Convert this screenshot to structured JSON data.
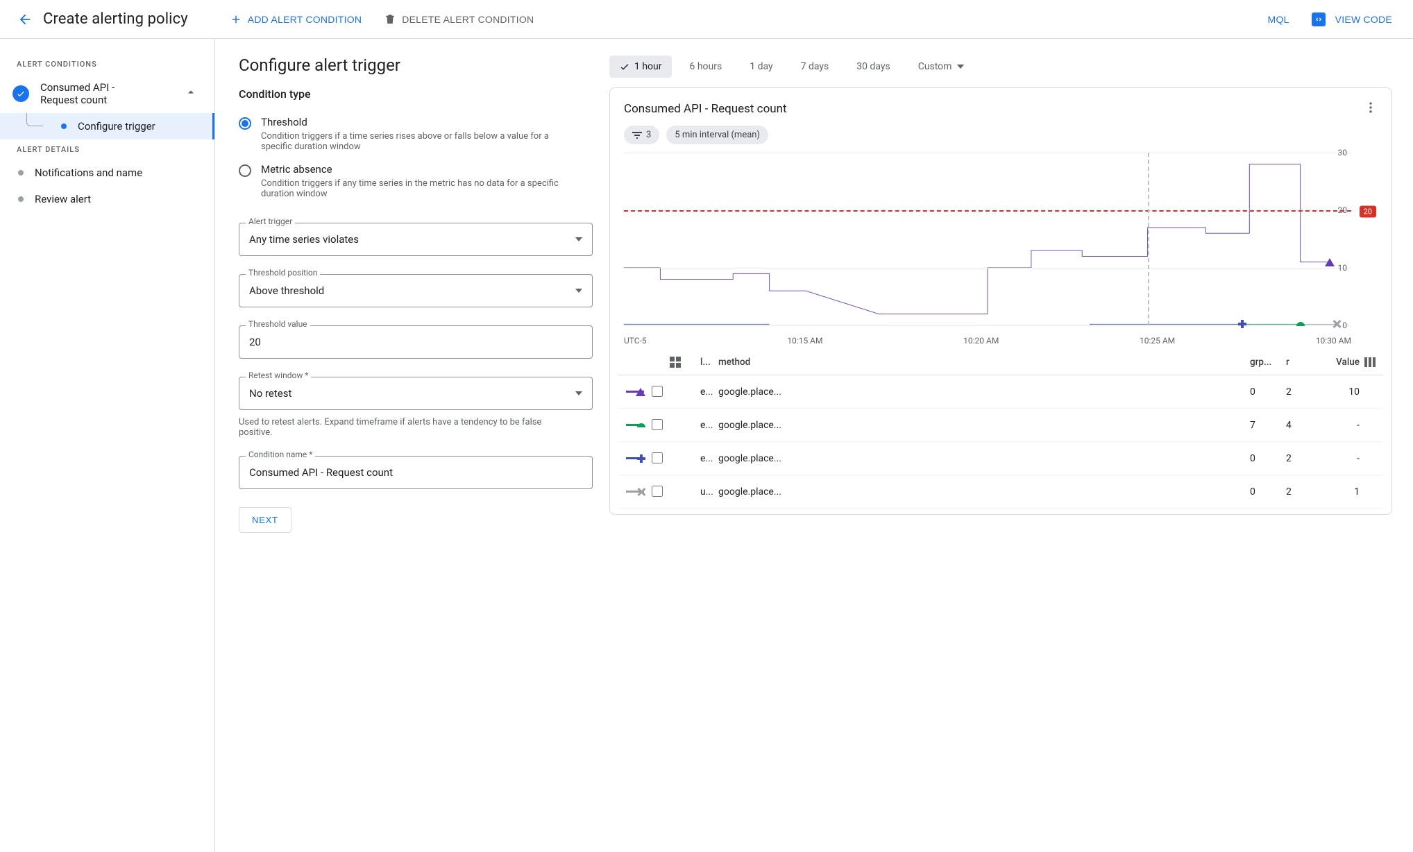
{
  "header": {
    "title": "Create alerting policy",
    "add_condition": "ADD ALERT CONDITION",
    "delete_condition": "DELETE ALERT CONDITION",
    "mql": "MQL",
    "view_code": "VIEW CODE"
  },
  "sidebar": {
    "conditions_h": "ALERT CONDITIONS",
    "condition_name": "Consumed API - Request count",
    "configure_trigger": "Configure trigger",
    "details_h": "ALERT DETAILS",
    "notifications": "Notifications and name",
    "review": "Review alert"
  },
  "form": {
    "title": "Configure alert trigger",
    "condition_type_h": "Condition type",
    "threshold": {
      "title": "Threshold",
      "desc": "Condition triggers if a time series rises above or falls below a value for a specific duration window"
    },
    "absence": {
      "title": "Metric absence",
      "desc": "Condition triggers if any time series in the metric has no data for a specific duration window"
    },
    "alert_trigger": {
      "label": "Alert trigger",
      "value": "Any time series violates"
    },
    "threshold_position": {
      "label": "Threshold position",
      "value": "Above threshold"
    },
    "threshold_value": {
      "label": "Threshold value",
      "value": "20"
    },
    "retest": {
      "label": "Retest window *",
      "value": "No retest",
      "hint": "Used to retest alerts. Expand timeframe if alerts have a tendency to be false positive."
    },
    "condition_name": {
      "label": "Condition name *",
      "value": "Consumed API - Request count"
    },
    "next": "NEXT"
  },
  "preview": {
    "time_ranges": [
      "1 hour",
      "6 hours",
      "1 day",
      "7 days",
      "30 days",
      "Custom"
    ],
    "active_range": 0,
    "panel_title": "Consumed API - Request count",
    "filter_count": "3",
    "interval_chip": "5 min interval (mean)",
    "tz": "UTC-5",
    "xticks": [
      "10:15 AM",
      "10:20 AM",
      "10:25 AM",
      "10:30 AM"
    ],
    "table_head": {
      "l1": "l...",
      "method": "method",
      "grp": "grp...",
      "r": "r",
      "value": "Value"
    },
    "rows": [
      {
        "sym": "tri",
        "color": "#673ab7",
        "l1": "e...",
        "method": "google.place...",
        "grp": "0",
        "r": "2",
        "value": "10"
      },
      {
        "sym": "semi",
        "color": "#0f9d58",
        "l1": "e...",
        "method": "google.place...",
        "grp": "7",
        "r": "4",
        "value": "-"
      },
      {
        "sym": "plus",
        "color": "#3f51b5",
        "l1": "e...",
        "method": "google.place...",
        "grp": "0",
        "r": "2",
        "value": "-"
      },
      {
        "sym": "x",
        "color": "#9aa0a6",
        "l1": "u...",
        "method": "google.place...",
        "grp": "0",
        "r": "2",
        "value": "1"
      }
    ]
  },
  "chart_data": {
    "type": "line",
    "title": "Consumed API - Request count",
    "ylim": [
      0,
      30
    ],
    "yticks": [
      0,
      10,
      20,
      30
    ],
    "threshold": 20,
    "x_hover_fraction": 0.72,
    "series": [
      {
        "name": "purple",
        "color": "#673ab7",
        "points": [
          [
            0,
            10
          ],
          [
            0.05,
            10
          ],
          [
            0.05,
            8
          ],
          [
            0.15,
            8
          ],
          [
            0.15,
            9
          ],
          [
            0.2,
            9
          ],
          [
            0.2,
            6
          ],
          [
            0.25,
            6
          ],
          [
            0.35,
            2
          ],
          [
            0.5,
            2
          ],
          [
            0.5,
            10
          ],
          [
            0.56,
            10
          ],
          [
            0.56,
            13
          ],
          [
            0.63,
            13
          ],
          [
            0.63,
            12
          ],
          [
            0.72,
            12
          ],
          [
            0.72,
            17
          ],
          [
            0.8,
            17
          ],
          [
            0.8,
            16
          ],
          [
            0.86,
            16
          ],
          [
            0.86,
            28
          ],
          [
            0.93,
            28
          ],
          [
            0.93,
            11
          ],
          [
            0.97,
            11
          ]
        ]
      },
      {
        "name": "blue-plus",
        "color": "#3f51b5",
        "points": [
          [
            0.0,
            0.2
          ],
          [
            0.2,
            0.2
          ]
        ]
      },
      {
        "name": "blue-plus-2",
        "color": "#3f51b5",
        "points": [
          [
            0.64,
            0.2
          ],
          [
            0.85,
            0.2
          ]
        ]
      },
      {
        "name": "green",
        "color": "#0f9d58",
        "points": [
          [
            0.85,
            0.2
          ],
          [
            0.93,
            0.2
          ]
        ]
      },
      {
        "name": "grey-x",
        "color": "#9aa0a6",
        "points": [
          [
            0.93,
            0.2
          ],
          [
            0.98,
            0.2
          ]
        ]
      }
    ]
  }
}
